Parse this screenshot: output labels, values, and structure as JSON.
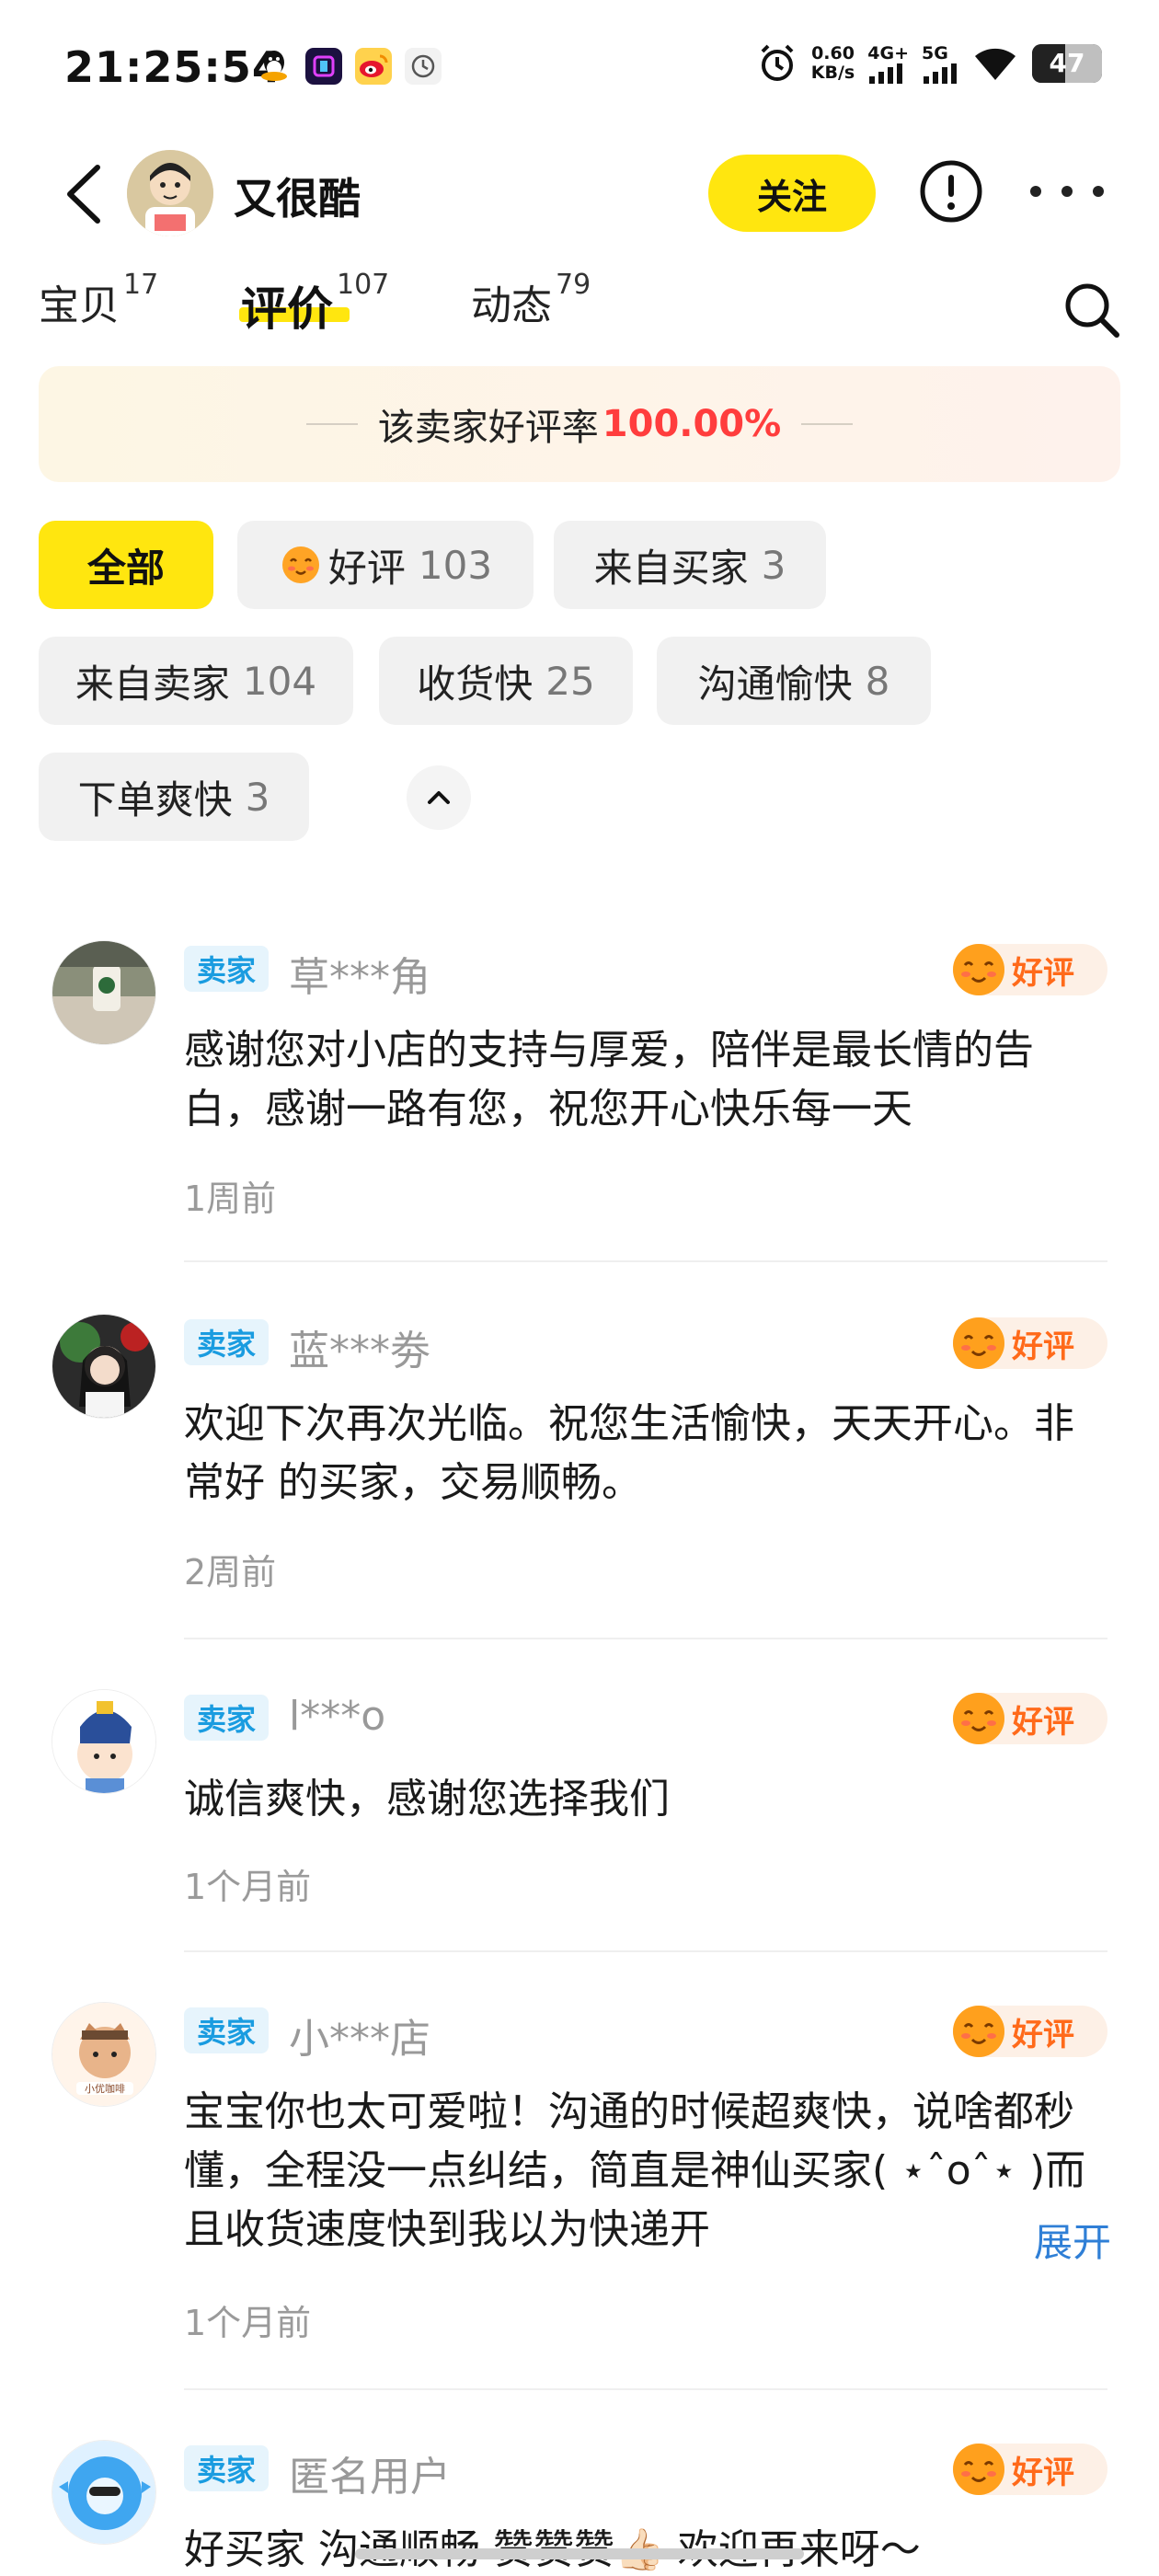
{
  "status_bar": {
    "time": "21:25:54",
    "net_speed_value": "0.60",
    "net_speed_unit": "KB/s",
    "network_1": "4G+",
    "network_2": "5G",
    "battery_level": "47",
    "battery_fraction": 0.47
  },
  "header": {
    "shop_name": "又很酷",
    "follow_label": "关注"
  },
  "tabs": [
    {
      "label": "宝贝",
      "count": "17"
    },
    {
      "label": "评价",
      "count": "107"
    },
    {
      "label": "动态",
      "count": "79"
    }
  ],
  "rating_banner": {
    "label": "该卖家好评率",
    "value": "100.00%"
  },
  "filters": [
    {
      "label": "全部",
      "count": ""
    },
    {
      "label": "好评",
      "count": "103"
    },
    {
      "label": "来自买家",
      "count": "3"
    },
    {
      "label": "来自卖家",
      "count": "104"
    },
    {
      "label": "收货快",
      "count": "25"
    },
    {
      "label": "沟通愉快",
      "count": "8"
    },
    {
      "label": "下单爽快",
      "count": "3"
    }
  ],
  "reviews": [
    {
      "tag": "卖家",
      "username": "草***角",
      "badge": "好评",
      "text": "感谢您对小店的支持与厚爱，陪伴是最长情的告白，感谢一路有您，祝您开心快乐每一天",
      "time": "1周前"
    },
    {
      "tag": "卖家",
      "username": "蓝***劵",
      "badge": "好评",
      "text": "欢迎下次再次光临。祝您生活愉快，天天开心。非常好 的买家，交易顺畅。",
      "time": "2周前"
    },
    {
      "tag": "卖家",
      "username": "l***o",
      "badge": "好评",
      "text": "诚信爽快，感谢您选择我们",
      "time": "1个月前"
    },
    {
      "tag": "卖家",
      "username": "小***店",
      "badge": "好评",
      "text": "宝宝你也太可爱啦！沟通的时候超爽快，说啥都秒懂，全程没一点纠结，简直是神仙买家( ⋆ˆoˆ⋆ )而且收货速度快到我以为快递开",
      "expand": "展开",
      "time": "1个月前"
    },
    {
      "tag": "卖家",
      "username": "匿名用户",
      "badge": "好评",
      "text": "好买家 沟通顺畅 赞赞赞👍🏻 欢迎再来呀～",
      "time": ""
    }
  ],
  "icons": {
    "back": "chevron-left-icon",
    "report": "exclamation-circle-icon",
    "more": "more-dots-icon",
    "search": "search-icon",
    "collapse": "chevron-up-icon",
    "good_review": "smiling-face-icon"
  },
  "colors": {
    "accent_yellow": "#ffe60f",
    "rating_red": "#ff3d3d",
    "seller_tag_blue": "#1a9ce0",
    "good_badge_orange": "#ff6a1a",
    "expand_blue": "#2f7fd6"
  }
}
